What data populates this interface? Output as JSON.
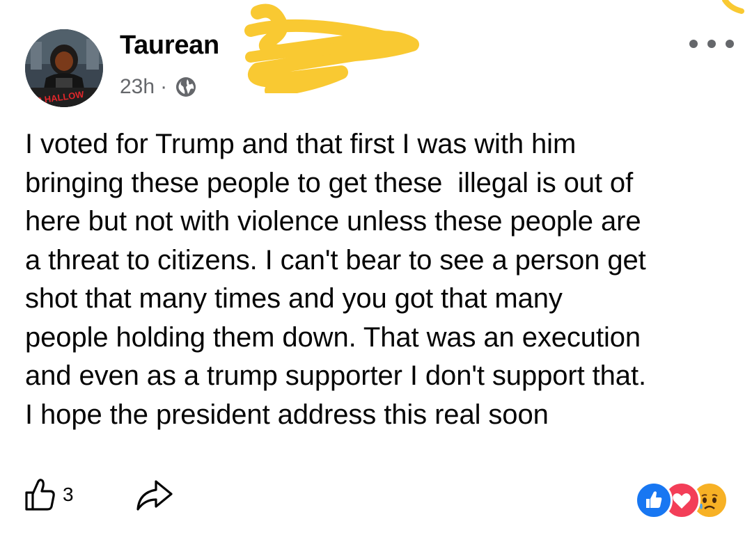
{
  "post": {
    "author_name": "Taurean",
    "timestamp": "23h",
    "separator": "·",
    "privacy_icon": "globe-icon",
    "more_icon": "more-dots-icon",
    "avatar_text": "MR HALLOW",
    "text": "I voted for Trump and that first I was with him\nbringing these people to get these  illegal is out of\nhere but not with violence unless these people are\na threat to citizens. I can't bear to see a person get\nshot that many times and you got that many\npeople holding them down. That was an execution\nand even as a trump supporter I don't support that.\nI hope the president address this real soon"
  },
  "footer": {
    "like_icon": "thumbs-up-icon",
    "like_count": "3",
    "share_icon": "share-arrow-icon",
    "reactions": [
      "like-reaction-icon",
      "love-reaction-icon",
      "sad-reaction-icon"
    ]
  },
  "colors": {
    "like_blue": "#1877f2",
    "love_red": "#f33e58",
    "sad_yellow": "#f7b125",
    "scribble_yellow": "#f9c932",
    "secondary_text": "#65676b"
  }
}
